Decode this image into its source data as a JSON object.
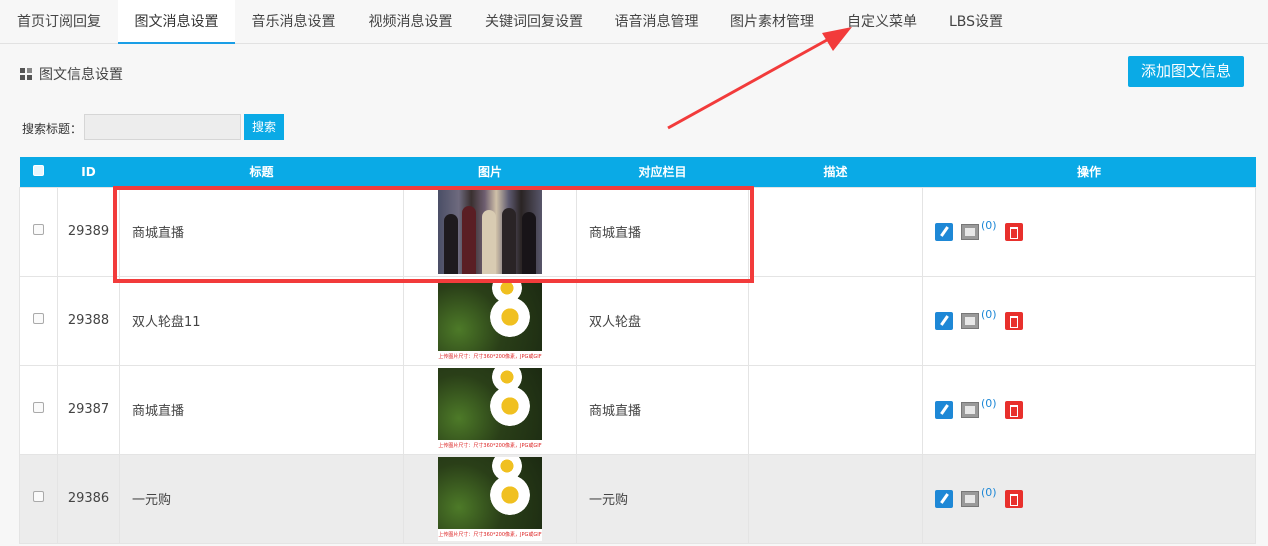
{
  "tabs": [
    {
      "label": "首页订阅回复",
      "active": false
    },
    {
      "label": "图文消息设置",
      "active": true
    },
    {
      "label": "音乐消息设置",
      "active": false
    },
    {
      "label": "视频消息设置",
      "active": false
    },
    {
      "label": "关键词回复设置",
      "active": false
    },
    {
      "label": "语音消息管理",
      "active": false
    },
    {
      "label": "图片素材管理",
      "active": false
    },
    {
      "label": "自定义菜单",
      "active": false
    },
    {
      "label": "LBS设置",
      "active": false
    }
  ],
  "section": {
    "title": "图文信息设置",
    "icon": "grid-icon"
  },
  "add_button": "添加图文信息",
  "search": {
    "label": "搜索标题：",
    "placeholder": "",
    "button": "搜索"
  },
  "table": {
    "headers": {
      "id": "ID",
      "title": "标题",
      "image": "图片",
      "column": "对应栏目",
      "desc": "描述",
      "ops": "操作"
    },
    "rows": [
      {
        "id": "29389",
        "title": "商城直播",
        "image": "fashion",
        "column": "商城直播",
        "desc": "",
        "count": "(0)"
      },
      {
        "id": "29388",
        "title": "双人轮盘11",
        "image": "daisy",
        "column": "双人轮盘",
        "desc": "",
        "count": "(0)"
      },
      {
        "id": "29387",
        "title": "商城直播",
        "image": "daisy",
        "column": "商城直播",
        "desc": "",
        "count": "(0)"
      },
      {
        "id": "29386",
        "title": "一元购",
        "image": "daisy",
        "column": "一元购",
        "desc": "",
        "count": "(0)"
      }
    ],
    "image_caption": "上传图片尺寸：尺寸360*200像素，JPG或GIF"
  },
  "colors": {
    "accent": "#0aaae6",
    "annotation": "#f23b3b",
    "delete": "#e8302c",
    "edit": "#1e88d6"
  }
}
